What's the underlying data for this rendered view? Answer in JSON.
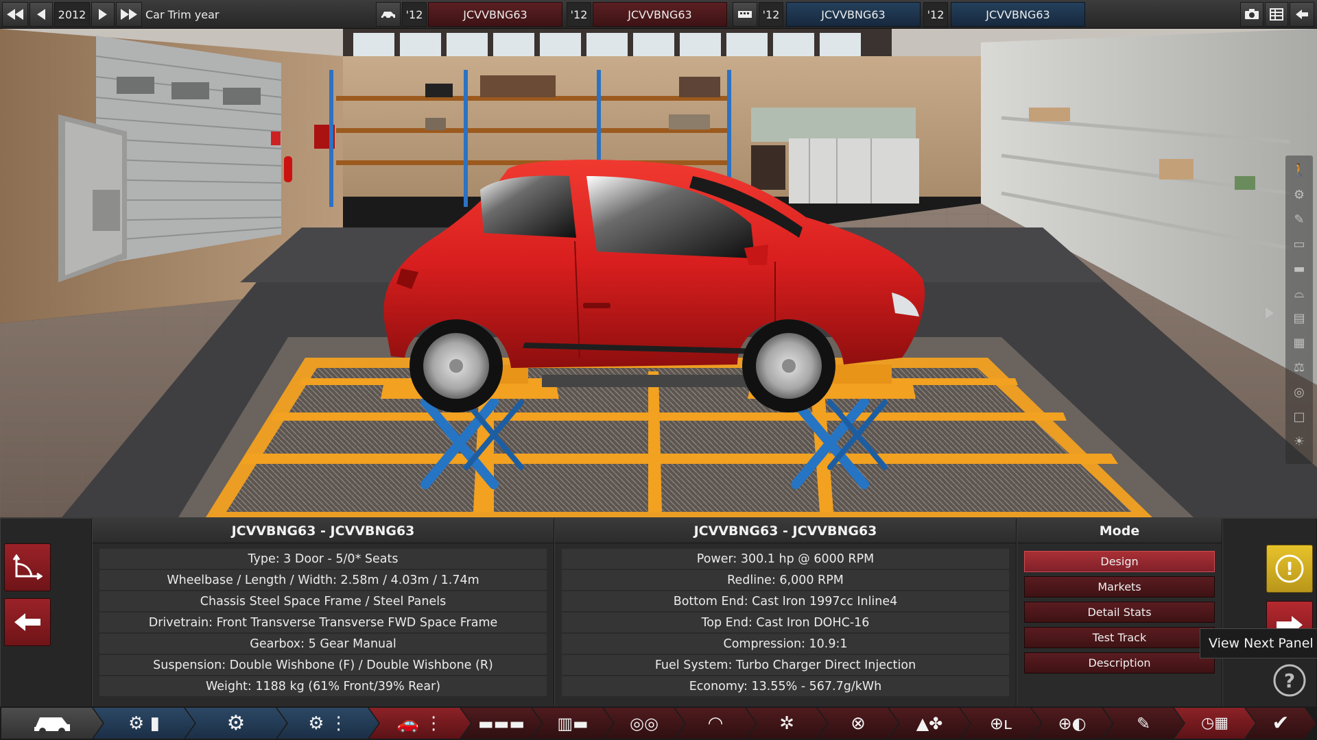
{
  "topbar": {
    "year": "2012",
    "year_label": "Car Trim year",
    "comparisons": [
      {
        "year": "'12",
        "name": "JCVVBNG63"
      },
      {
        "year": "'12",
        "name": "JCVVBNG63"
      },
      {
        "year": "'12",
        "name": "JCVVBNG63"
      },
      {
        "year": "'12",
        "name": "JCVVBNG63"
      }
    ]
  },
  "panel": {
    "car_title": "JCVVBNG63 - JCVVBNG63",
    "car_stats": [
      "Type: 3 Door - 5/0* Seats",
      "Wheelbase / Length / Width: 2.58m / 4.03m / 1.74m",
      "Chassis Steel Space Frame / Steel Panels",
      "Drivetrain: Front Transverse Transverse FWD Space Frame",
      "Gearbox: 5 Gear Manual",
      "Suspension: Double Wishbone (F) / Double Wishbone (R)",
      "Weight: 1188 kg (61% Front/39% Rear)"
    ],
    "engine_title": "JCVVBNG63 - JCVVBNG63",
    "engine_stats": [
      "Power: 300.1 hp @ 6000 RPM",
      "Redline:  6,000 RPM",
      "Bottom End: Cast Iron 1997cc Inline4",
      "Top End: Cast Iron DOHC-16",
      "Compression: 10.9:1",
      "Fuel System: Turbo Charger Direct Injection",
      "Economy: 13.55% - 567.7g/kWh"
    ],
    "mode_title": "Mode",
    "modes": [
      "Design",
      "Markets",
      "Detail Stats",
      "Test Track",
      "Description"
    ],
    "active_mode": "Design",
    "tooltip": "View Next Panel",
    "help_glyph": "?",
    "warn_glyph": "!"
  },
  "colors": {
    "car_red": "#d81e1e",
    "accent_red": "#a93035",
    "accent_blue": "#24405c",
    "warn_yellow": "#e6c32a"
  }
}
